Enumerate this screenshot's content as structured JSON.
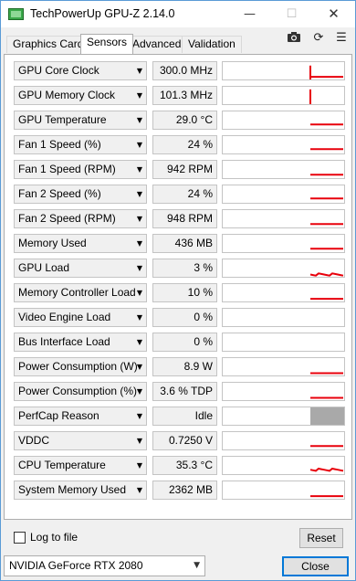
{
  "window": {
    "title": "TechPowerUp GPU-Z 2.14.0",
    "min_icon": "minimize-icon",
    "max_icon": "maximize-icon",
    "close_icon": "close-icon"
  },
  "tabs": [
    {
      "label": "Graphics Card",
      "active": false
    },
    {
      "label": "Sensors",
      "active": true
    },
    {
      "label": "Advanced",
      "active": false
    },
    {
      "label": "Validation",
      "active": false
    }
  ],
  "toolbar_icons": [
    "camera-icon",
    "refresh-icon",
    "menu-icon"
  ],
  "colors": {
    "graph_line": "#e8000b",
    "perfcap_block": "#a9a9a9",
    "accent": "#0078d7"
  },
  "sensors": [
    {
      "label": "GPU Core Clock",
      "value": "300.0 MHz",
      "graph": {
        "type": "spike",
        "level": 0.1,
        "spike": 0.8
      }
    },
    {
      "label": "GPU Memory Clock",
      "value": "101.3 MHz",
      "graph": {
        "type": "spike-only",
        "spike": 0.85
      }
    },
    {
      "label": "GPU Temperature",
      "value": "29.0 °C",
      "graph": {
        "type": "flat",
        "level": 0.2
      }
    },
    {
      "label": "Fan 1 Speed (%)",
      "value": "24 %",
      "graph": {
        "type": "flat",
        "level": 0.2
      }
    },
    {
      "label": "Fan 1 Speed (RPM)",
      "value": "942 RPM",
      "graph": {
        "type": "flat",
        "level": 0.15
      }
    },
    {
      "label": "Fan 2 Speed (%)",
      "value": "24 %",
      "graph": {
        "type": "flat",
        "level": 0.2
      }
    },
    {
      "label": "Fan 2 Speed (RPM)",
      "value": "948 RPM",
      "graph": {
        "type": "flat",
        "level": 0.15
      }
    },
    {
      "label": "Memory Used",
      "value": "436 MB",
      "graph": {
        "type": "flat",
        "level": 0.15
      }
    },
    {
      "label": "GPU Load",
      "value": "3 %",
      "graph": {
        "type": "noise",
        "level": 0.08
      }
    },
    {
      "label": "Memory Controller Load",
      "value": "10 %",
      "graph": {
        "type": "flat",
        "level": 0.1
      }
    },
    {
      "label": "Video Engine Load",
      "value": "0 %",
      "graph": {
        "type": "none"
      }
    },
    {
      "label": "Bus Interface Load",
      "value": "0 %",
      "graph": {
        "type": "none"
      }
    },
    {
      "label": "Power Consumption (W)",
      "value": "8.9 W",
      "graph": {
        "type": "flat",
        "level": 0.08
      }
    },
    {
      "label": "Power Consumption (%)",
      "value": "3.6 % TDP",
      "graph": {
        "type": "flat",
        "level": 0.08
      }
    },
    {
      "label": "PerfCap Reason",
      "value": "Idle",
      "graph": {
        "type": "block"
      }
    },
    {
      "label": "VDDC",
      "value": "0.7250 V",
      "graph": {
        "type": "flat",
        "level": 0.15
      }
    },
    {
      "label": "CPU Temperature",
      "value": "35.3 °C",
      "graph": {
        "type": "noise",
        "level": 0.2
      }
    },
    {
      "label": "System Memory Used",
      "value": "2362 MB",
      "graph": {
        "type": "flat",
        "level": 0.1
      }
    }
  ],
  "footer": {
    "log_label": "Log to file",
    "log_checked": false,
    "reset_label": "Reset",
    "device": "NVIDIA GeForce RTX 2080",
    "close_label": "Close"
  }
}
